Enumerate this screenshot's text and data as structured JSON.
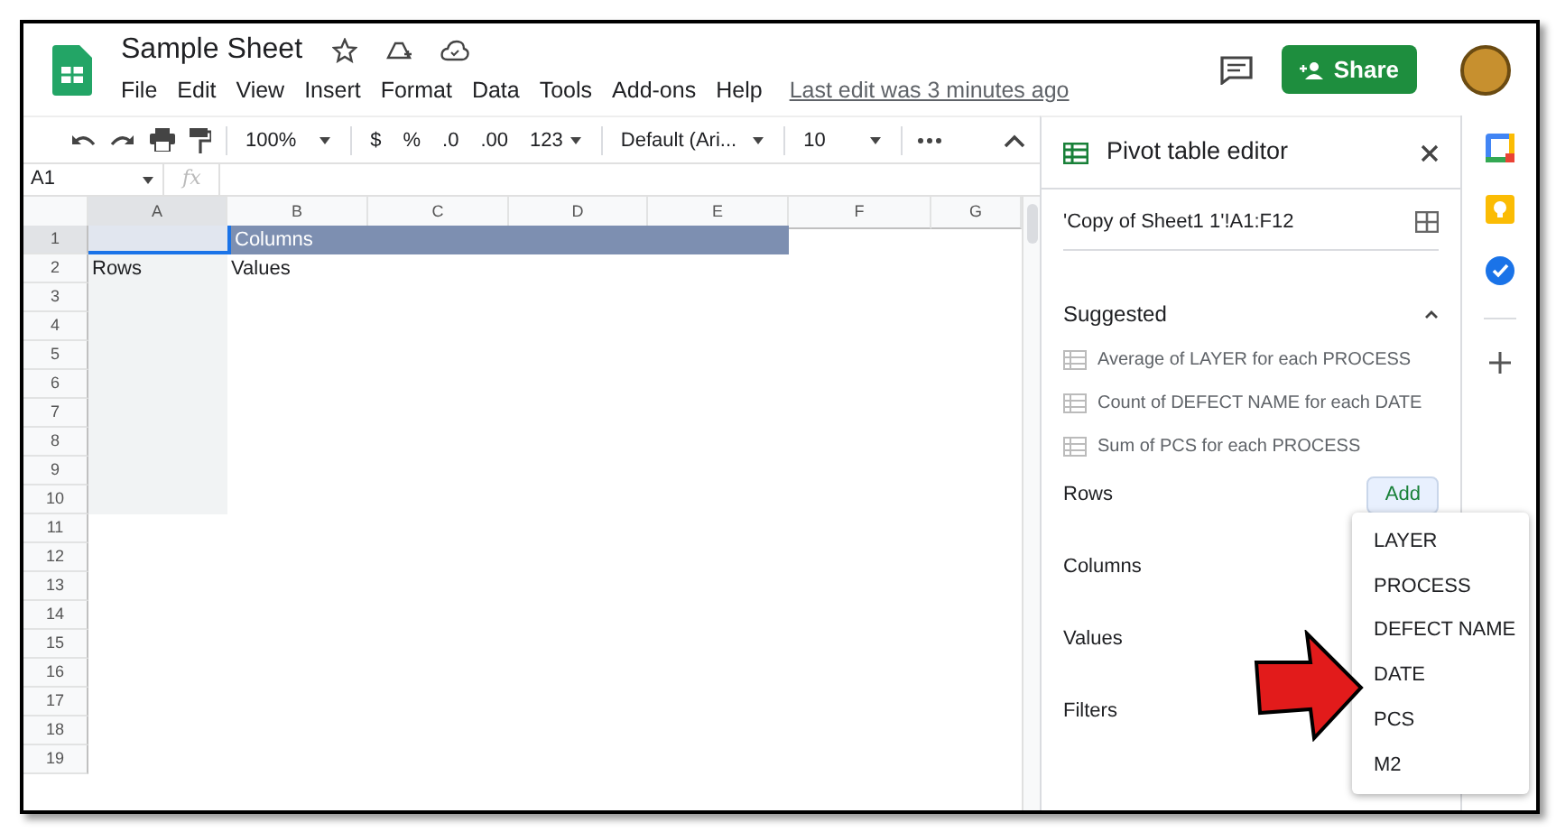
{
  "app": {
    "title": "Sample Sheet",
    "menu": [
      "File",
      "Edit",
      "View",
      "Insert",
      "Format",
      "Data",
      "Tools",
      "Add-ons",
      "Help"
    ],
    "last_edit": "Last edit was 3 minutes ago",
    "share_button": "Share"
  },
  "toolbar": {
    "zoom": "100%",
    "currency": "$",
    "percent": "%",
    "decrease_decimals": ".0",
    "increase_decimals": ".00",
    "number_format": "123",
    "font": "Default (Ari...",
    "font_size": "10"
  },
  "formula_bar": {
    "name_box": "A1",
    "fx": "fx"
  },
  "sheet": {
    "columns": [
      {
        "label": "A",
        "selected": true
      },
      {
        "label": "B",
        "selected": false
      },
      {
        "label": "C",
        "selected": false
      },
      {
        "label": "D",
        "selected": false
      },
      {
        "label": "E",
        "selected": false
      },
      {
        "label": "F",
        "selected": false
      },
      {
        "label": "G",
        "selected": false
      }
    ],
    "rows": [
      {
        "label": "1",
        "selected": true,
        "kind": "band",
        "cells": [
          "",
          "Columns"
        ]
      },
      {
        "label": "2",
        "selected": false,
        "kind": "pivot",
        "cells": [
          "Rows",
          "Values"
        ]
      },
      {
        "label": "3",
        "selected": false,
        "kind": "pivot"
      },
      {
        "label": "4",
        "selected": false,
        "kind": "pivot"
      },
      {
        "label": "5",
        "selected": false,
        "kind": "pivot"
      },
      {
        "label": "6",
        "selected": false,
        "kind": "pivot"
      },
      {
        "label": "7",
        "selected": false,
        "kind": "pivot"
      },
      {
        "label": "8",
        "selected": false,
        "kind": "pivot"
      },
      {
        "label": "9",
        "selected": false,
        "kind": "pivot"
      },
      {
        "label": "10",
        "selected": false,
        "kind": "pivot"
      },
      {
        "label": "11",
        "selected": false,
        "kind": "empty"
      },
      {
        "label": "12",
        "selected": false,
        "kind": "empty"
      },
      {
        "label": "13",
        "selected": false,
        "kind": "empty"
      },
      {
        "label": "14",
        "selected": false,
        "kind": "empty"
      },
      {
        "label": "15",
        "selected": false,
        "kind": "empty"
      },
      {
        "label": "16",
        "selected": false,
        "kind": "empty"
      },
      {
        "label": "17",
        "selected": false,
        "kind": "empty"
      },
      {
        "label": "18",
        "selected": false,
        "kind": "empty"
      },
      {
        "label": "19",
        "selected": false,
        "kind": "empty"
      }
    ]
  },
  "pivot_editor": {
    "title": "Pivot table editor",
    "range": "'Copy of Sheet1 1'!A1:F12",
    "suggested": {
      "heading": "Suggested",
      "expanded": true,
      "items": [
        "Average of LAYER for each PROCESS",
        "Count of DEFECT NAME for each DATE",
        "Sum of PCS for each PROCESS"
      ]
    },
    "sections": [
      "Rows",
      "Columns",
      "Values",
      "Filters"
    ],
    "add_button": "Add",
    "add_menu": [
      "LAYER",
      "PROCESS",
      "DEFECT NAME",
      "DATE",
      "PCS",
      "M2"
    ]
  }
}
